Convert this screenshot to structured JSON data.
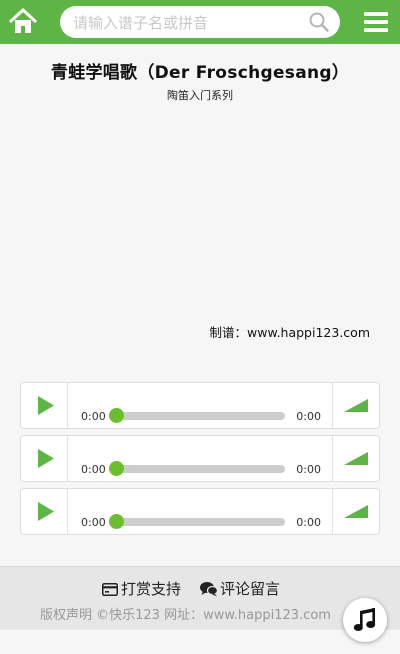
{
  "header": {
    "search_placeholder": "请输入谱子名或拼音",
    "home_icon": "home-icon",
    "search_icon": "search-icon",
    "menu_icon": "menu-icon",
    "accent": "#5cb545"
  },
  "song": {
    "title": "青蛙学唱歌（Der Froschgesang）",
    "subtitle": "陶笛入门系列",
    "credit": "制谱：www.happi123.com"
  },
  "players": [
    {
      "current_time": "0:00",
      "duration": "0:00",
      "progress": 0
    },
    {
      "current_time": "0:00",
      "duration": "0:00",
      "progress": 0
    },
    {
      "current_time": "0:00",
      "duration": "0:00",
      "progress": 0
    }
  ],
  "footer": {
    "reward_label": "打赏支持",
    "comment_label": "评论留言",
    "copyright_line": "版权声明 ©快乐123 网址：www.happi123.com"
  },
  "music_button": {
    "icon": "music-note-icon"
  }
}
